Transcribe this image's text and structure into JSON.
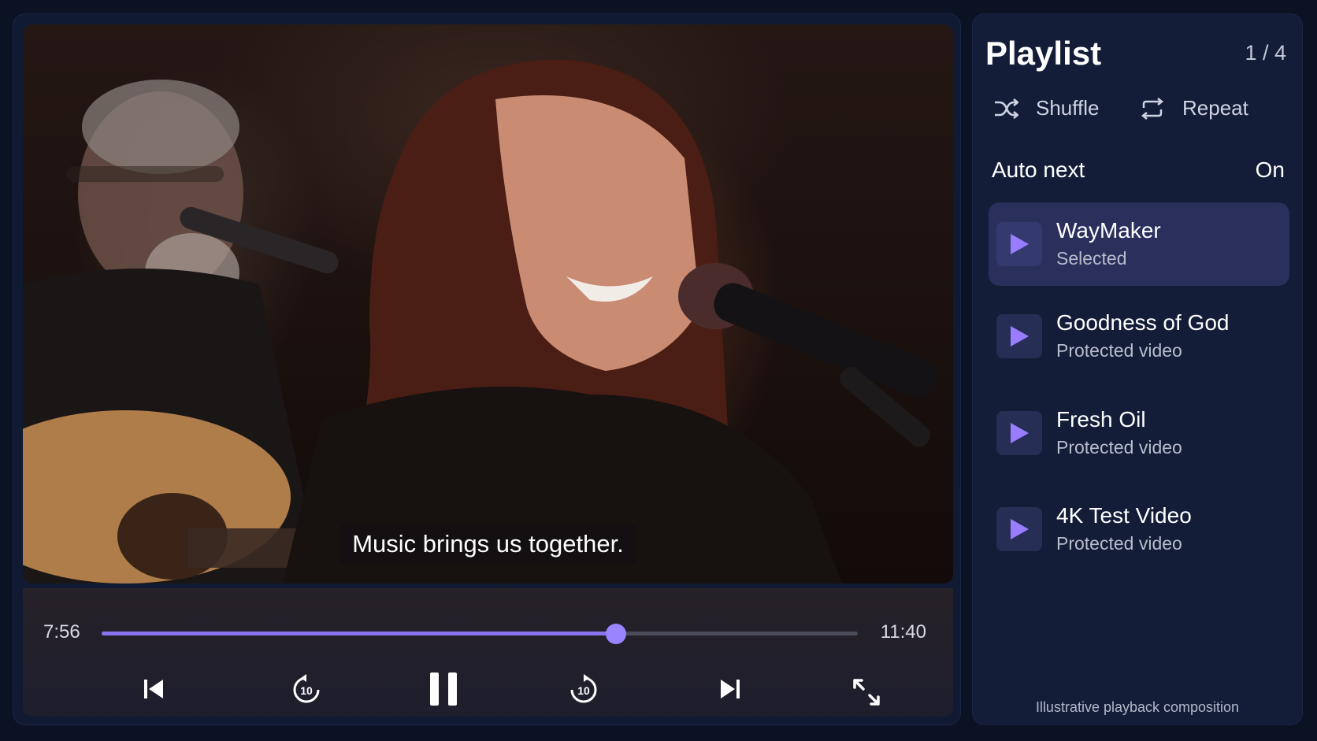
{
  "video": {
    "subtitle": "Music brings us together.",
    "current_time": "7:56",
    "duration": "11:40",
    "progress_fraction": 0.68,
    "state": "playing",
    "rewind_seconds": "10",
    "forward_seconds": "10"
  },
  "playlist": {
    "title": "Playlist",
    "position": "1 / 4",
    "shuffle_label": "Shuffle",
    "repeat_label": "Repeat",
    "auto_next_label": "Auto next",
    "auto_next_value": "On",
    "items": [
      {
        "title": "WayMaker",
        "subtitle": "Selected",
        "selected": true
      },
      {
        "title": "Goodness of God",
        "subtitle": "Protected video",
        "selected": false
      },
      {
        "title": "Fresh Oil",
        "subtitle": "Protected video",
        "selected": false
      },
      {
        "title": "4K Test Video",
        "subtitle": "Protected video",
        "selected": false
      }
    ],
    "footnote": "Illustrative playback composition"
  },
  "colors": {
    "accent": "#8b74f0",
    "background": "#0b1224",
    "panel": "#131d38",
    "selected_item": "#2a2f5c"
  },
  "icons": [
    "shuffle-icon",
    "repeat-icon",
    "play-icon",
    "previous-icon",
    "rewind-10-icon",
    "pause-icon",
    "forward-10-icon",
    "next-icon",
    "fullscreen-icon"
  ]
}
